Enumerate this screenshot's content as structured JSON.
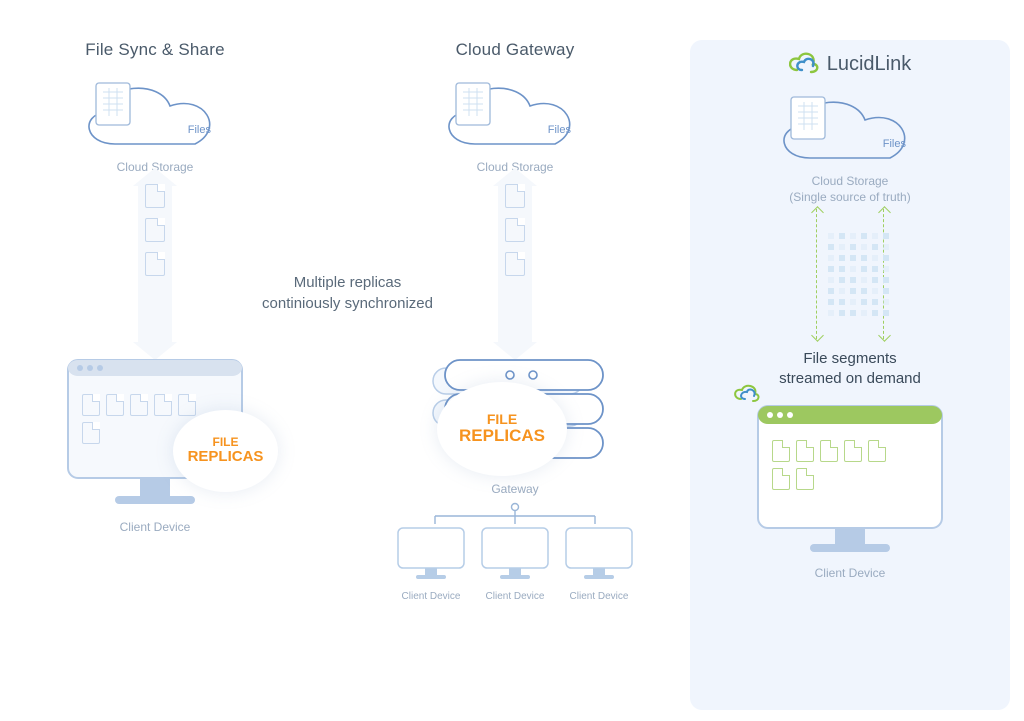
{
  "columns": {
    "sync": {
      "title": "File Sync & Share",
      "cloud_label": "Files",
      "cloud_caption": "Cloud Storage",
      "badge_line1": "FILE",
      "badge_line2": "REPLICAS",
      "device_caption": "Client Device"
    },
    "gateway": {
      "title": "Cloud Gateway",
      "cloud_label": "Files",
      "cloud_caption": "Cloud Storage",
      "badge_line1": "FILE",
      "badge_line2": "REPLICAS",
      "mid_caption": "Gateway",
      "client_dev": "Client Device"
    },
    "lucid": {
      "brand": "LucidLink",
      "cloud_label": "Files",
      "cloud_caption": "Cloud Storage\n(Single source of truth)",
      "stream_caption": "File segments\nstreamed on demand",
      "device_caption": "Client Device"
    }
  },
  "center_note": "Multiple replicas\ncontiniously synchronized"
}
